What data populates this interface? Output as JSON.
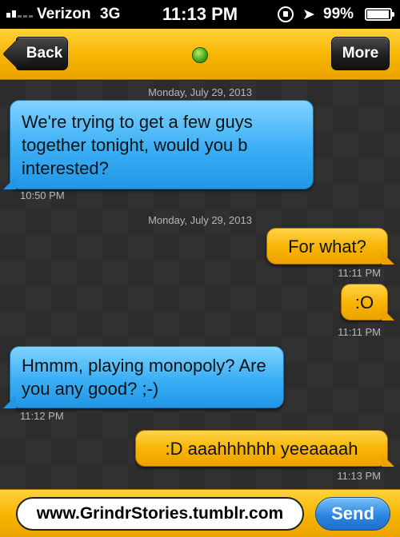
{
  "status_bar": {
    "carrier": "Verizon",
    "network": "3G",
    "time": "11:13 PM",
    "battery": "99%",
    "icons": [
      "signal-icon",
      "rotation-lock-icon",
      "location-arrow-icon",
      "battery-icon"
    ]
  },
  "nav": {
    "back_label": "Back",
    "more_label": "More",
    "online_status_color": "#3fa415"
  },
  "messages": [
    {
      "date": "Monday, July 29, 2013",
      "text": "We're trying to get a few guys together tonight, would you b interested?",
      "time": "10:50 PM",
      "direction": "incoming"
    },
    {
      "date": "Monday, July 29, 2013",
      "text": "For what?",
      "time": "11:11 PM",
      "direction": "outgoing"
    },
    {
      "text": ":O",
      "time": "11:11 PM",
      "direction": "outgoing"
    },
    {
      "text": "Hmmm, playing monopoly? Are you any good? ;-)",
      "time": "11:12 PM",
      "direction": "incoming"
    },
    {
      "text": ":D aaahhhhhh yeeaaaah",
      "time": "11:13 PM",
      "direction": "outgoing"
    }
  ],
  "input": {
    "value": "www.GrindrStories.tumblr.com",
    "send_label": "Send"
  },
  "colors": {
    "header_yellow": "#f6b400",
    "incoming_bubble": "#3aaef5",
    "outgoing_bubble": "#f7b300",
    "send_button": "#2b86e0"
  }
}
